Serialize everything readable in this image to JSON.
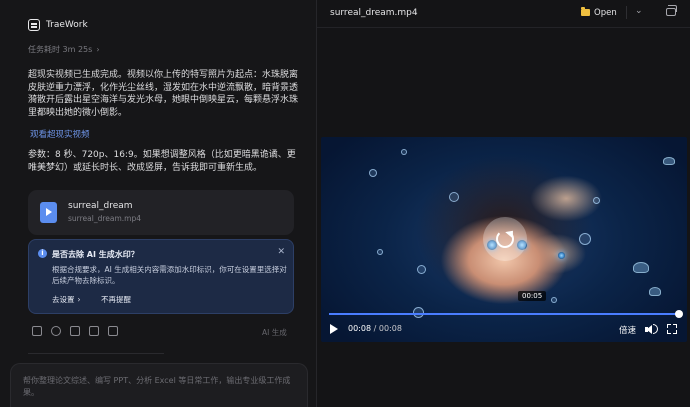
{
  "app": {
    "name": "TraeWork"
  },
  "task": {
    "elapsed_label": "任务耗时 3m 25s",
    "elapsed_chevron": "›"
  },
  "chat": {
    "message": "超现实视频已生成完成。视频以你上传的特写照片为起点：水珠脱离皮肤逆重力漂浮，化作光尘丝线，湿发如在水中逆流飘散，暗背景透漪散开后露出星空海洋与发光水母，她眼中倒映星云，每颗悬浮水珠里都映出她的微小倒影。",
    "view_link": "观看超现实视频",
    "params": "参数：8 秒、720p、16:9。如果想调整风格（比如更暗黑诡谲、更唯美梦幻）或延长时长、改成竖屏，告诉我即可重新生成。"
  },
  "file_card": {
    "name": "surreal_dream",
    "filename": "surreal_dream.mp4",
    "icon": "video-file-icon"
  },
  "notice": {
    "title": "是否去除 AI 生成水印？",
    "body": "根据合规要求，AI 生成相关内容需添加水印标识，你可在设置里选择对后续产物去除标识。",
    "settings_button": "去设置",
    "settings_chevron": "›",
    "dismiss_button": "不再提醒",
    "close": "✕"
  },
  "actions": {
    "icons": [
      "copy-icon",
      "retry-icon",
      "share-icon",
      "thumbs-up-icon",
      "thumbs-down-icon"
    ],
    "ai_tag": "AI 生成"
  },
  "composer": {
    "placeholder": "帮你整理论文综述、编写 PPT、分析 Excel 等日常工作，输出专业级工作成果。"
  },
  "preview": {
    "title": "surreal_dream.mp4",
    "open_label": "Open",
    "open_chevron": "⌄"
  },
  "player": {
    "hover_time": "00:05",
    "current_time": "00:08",
    "separator": "/",
    "duration": "00:08",
    "speed_label": "倍速",
    "progress": 1.0,
    "accent": "#4a7dff"
  },
  "colors": {
    "link": "#6e94e6",
    "notice_bg": "#1d2a45",
    "brand_icon": "#5b8def",
    "folder": "#f0c040"
  }
}
